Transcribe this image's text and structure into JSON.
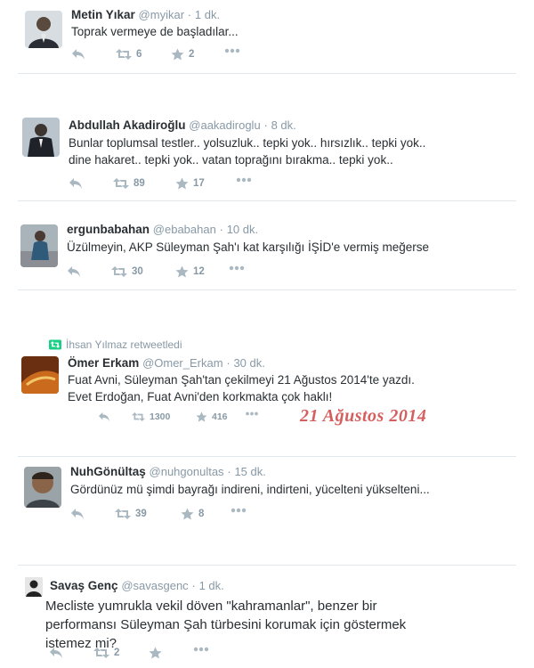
{
  "tweets": [
    {
      "name": "Metin Yıkar",
      "handle": "@myikar",
      "time": "1 dk.",
      "text": "Toprak vermeye de başladılar...",
      "retweets": "6",
      "favorites": "2"
    },
    {
      "name": "Abdullah Akadiroğlu",
      "handle": "@aakadiroglu",
      "time": "8 dk.",
      "text": "Bunlar toplumsal testler.. yolsuzluk.. tepki yok.. hırsızlık.. tepki yok.. dine hakaret.. tepki yok.. vatan toprağını bırakma.. tepki yok..",
      "retweets": "89",
      "favorites": "17"
    },
    {
      "name": "ergunbabahan",
      "handle": "@ebabahan",
      "time": "10 dk.",
      "text": "Üzülmeyin, AKP Süleyman Şah'ı kat karşılığı İŞİD'e vermiş meğerse",
      "retweets": "30",
      "favorites": "12"
    },
    {
      "retweeted_by": "İhsan Yılmaz retweetledi",
      "name": "Ömer Erkam",
      "handle": "@Omer_Erkam",
      "time": "30 dk.",
      "text": "Fuat Avni, Süleyman Şah'tan çekilmeyi 21 Ağustos 2014'te yazdı. Evet Erdoğan, Fuat Avni'den korkmakta çok haklı!",
      "retweets": "1300",
      "favorites": "416",
      "image_caption": "21 Ağustos 2014"
    },
    {
      "name": "NuhGönültaş",
      "handle": "@nuhgonultas",
      "time": "15 dk.",
      "text": "Gördünüz mü şimdi bayrağı indireni, indirteni, yücelteni yükselteni...",
      "retweets": "39",
      "favorites": "8"
    },
    {
      "name": "Savaş Genç",
      "handle": "@savasgenc",
      "time": "1 dk.",
      "text": "Mecliste yumrukla vekil döven \"kahramanlar\", benzer bir performansı Süleyman Şah türbesini korumak için göstermek istemez mi?",
      "retweets": "2",
      "favorites": ""
    }
  ],
  "icons": [
    "reply-icon",
    "retweet-icon",
    "favorite-icon",
    "more-icon"
  ],
  "colors": {
    "text": "#292f33",
    "muted": "#8899a6",
    "divider": "#e1e8ed",
    "retweet_green": "#19cf86",
    "watermark": "#d55f5f"
  }
}
